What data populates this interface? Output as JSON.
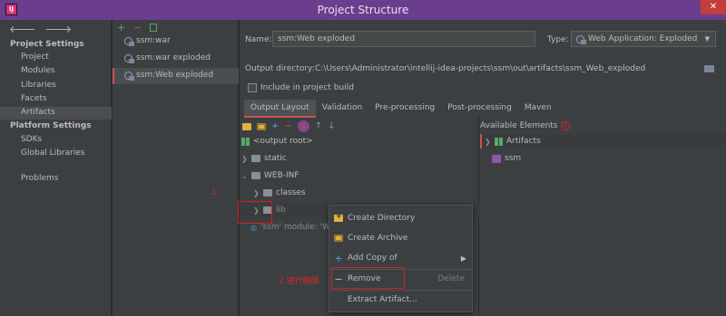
{
  "window": {
    "title": "Project Structure",
    "close": "✕"
  },
  "nav": {
    "project_settings": "Project Settings",
    "items1": [
      "Project",
      "Modules",
      "Libraries",
      "Facets",
      "Artifacts"
    ],
    "platform_settings": "Platform Settings",
    "items2": [
      "SDKs",
      "Global Libraries"
    ],
    "problems": "Problems",
    "selected": "Artifacts"
  },
  "artifacts_list": {
    "items": [
      "ssm:war",
      "ssm:war exploded",
      "ssm:Web exploded"
    ],
    "selected": "ssm:Web exploded"
  },
  "form": {
    "name_label": "Name:",
    "name_value": "ssm:Web exploded",
    "type_label": "Type:",
    "type_value": "Web Application: Exploded",
    "output_label": "Output directory:",
    "output_value": "C:\\Users\\Administrator\\intellij-idea-projects\\ssm\\out\\artifacts\\ssm_Web_exploded",
    "include_label": "Include in project build"
  },
  "tabs": [
    "Output Layout",
    "Validation",
    "Pre-processing",
    "Post-processing",
    "Maven"
  ],
  "active_tab": "Output Layout",
  "tree": {
    "root": "<output root>",
    "static": "static",
    "webinf": "WEB-INF",
    "classes": "classes",
    "lib": "lib",
    "module": "'ssm' module: 'Web"
  },
  "available": {
    "header": "Available Elements",
    "artifacts": "Artifacts",
    "ssm": "ssm"
  },
  "context_menu": {
    "create_directory": "Create Directory",
    "create_archive": "Create Archive",
    "add_copy_of": "Add Copy of",
    "remove": "Remove",
    "remove_shortcut": "Delete",
    "extract_artifact": "Extract Artifact..."
  },
  "annotations": {
    "step1": "1",
    "step2": "2 进行删除"
  },
  "colors": {
    "titlebar": "#6a3d8e",
    "background": "#3c3f41",
    "accent_red": "#c75450",
    "annotation_red": "#d42020"
  }
}
